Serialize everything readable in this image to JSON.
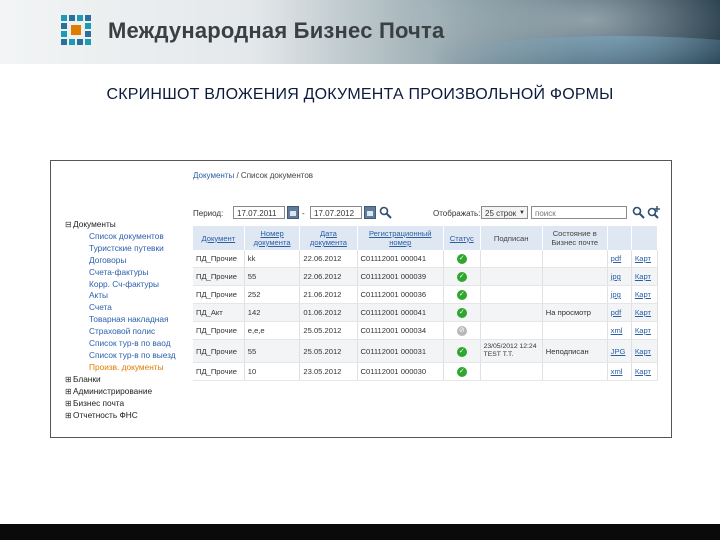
{
  "header": {
    "logo_text": "Международная Бизнес Почта"
  },
  "title": "СКРИНШОТ ВЛОЖЕНИЯ ДОКУМЕНТА ПРОИЗВОЛЬНОЙ ФОРМЫ",
  "breadcrumb": {
    "link": "Документы",
    "sep": " / ",
    "current": "Список документов"
  },
  "tree": {
    "root": "Документы",
    "children": [
      "Список документов",
      "Туристские путевки",
      "Договоры",
      "Счета-фактуры",
      "Корр. Сч-фактуры",
      "Акты",
      "Счета",
      "Товарная накладная",
      "Страховой полис",
      "Список тур-в по ваод",
      "Список тур-в по выезд"
    ],
    "active": "Произв. документы",
    "others": [
      "Бланки",
      "Администрирование",
      "Бизнес почта",
      "Отчетность ФНС"
    ]
  },
  "filters": {
    "period_label": "Период:",
    "date_from": "17.07.2011",
    "dash": "-",
    "date_to": "17.07.2012",
    "display_label": "Отображать:",
    "rows_select": "25 строк",
    "search_placeholder": "поиск"
  },
  "table": {
    "headers": [
      "Документ",
      "Номер документа",
      "Дата документа",
      "Регистрационный номер",
      "Статус",
      "Подписан",
      "Состояние в Бизнес почте",
      "",
      ""
    ],
    "rows": [
      {
        "doc": "ПД_Прочие",
        "num": "kk",
        "date": "22.06.2012",
        "reg": "C01112001 000041",
        "status": "ok",
        "signed": "",
        "state": "",
        "file": "pdf",
        "card": "Карт"
      },
      {
        "doc": "ПД_Прочие",
        "num": "55",
        "date": "22.06.2012",
        "reg": "C01112001 000039",
        "status": "ok",
        "signed": "",
        "state": "",
        "file": "jpg",
        "card": "Карт"
      },
      {
        "doc": "ПД_Прочие",
        "num": "252",
        "date": "21.06.2012",
        "reg": "C01112001 000036",
        "status": "ok",
        "signed": "",
        "state": "",
        "file": "jpg",
        "card": "Карт"
      },
      {
        "doc": "ПД_Акт",
        "num": "142",
        "date": "01.06.2012",
        "reg": "C01112001 000041",
        "status": "ok",
        "signed": "",
        "state": "На просмотр",
        "file": "pdf",
        "card": "Карт"
      },
      {
        "doc": "ПД_Прочие",
        "num": "e,e,e",
        "date": "25.05.2012",
        "reg": "C01112001 000034",
        "status": "wait",
        "signed": "",
        "state": "",
        "file": "xml",
        "card": "Карт"
      },
      {
        "doc": "ПД_Прочие",
        "num": "55",
        "date": "25.05.2012",
        "reg": "C01112001 000031",
        "status": "ok",
        "signed": "23/05/2012 12:24 TEST Т.Т.",
        "state": "Неподписан",
        "file": "JPG",
        "card": "Карт"
      },
      {
        "doc": "ПД_Прочие",
        "num": "10",
        "date": "23.05.2012",
        "reg": "C01112001 000030",
        "status": "ok",
        "signed": "",
        "state": "",
        "file": "xml",
        "card": "Карт"
      }
    ]
  }
}
